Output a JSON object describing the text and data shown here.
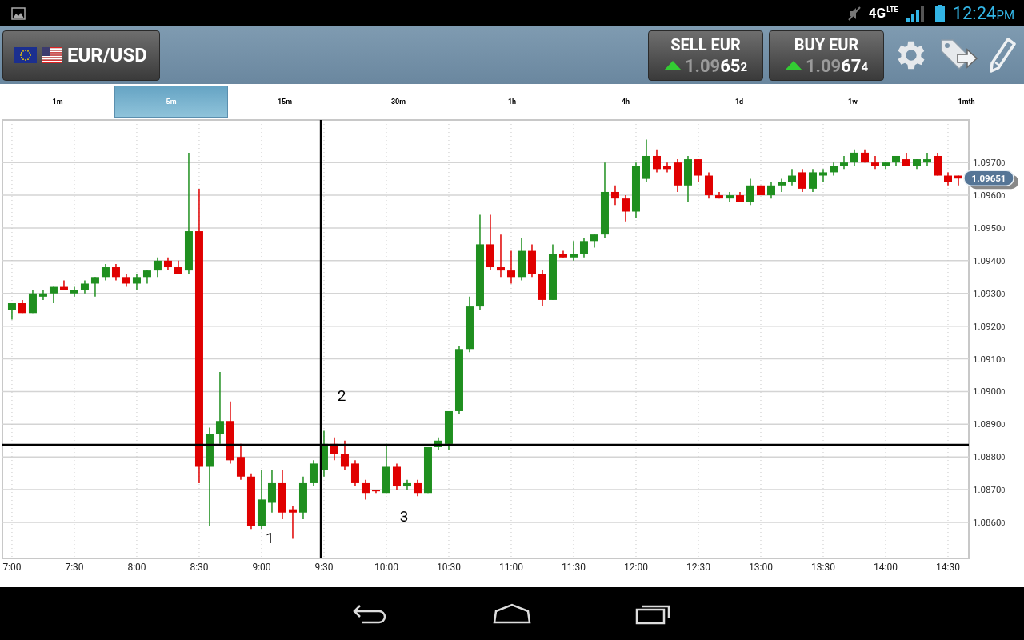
{
  "status_bar": {
    "network": "4G",
    "network_sub": "LTE",
    "time": "12:24",
    "meridiem": "PM"
  },
  "header": {
    "pair": "EUR/USD",
    "quotes": [
      {
        "label": "SELL EUR",
        "price_lead": "1.09",
        "price_pips": "65",
        "price_tail": "2"
      },
      {
        "label": "BUY EUR",
        "price_lead": "1.09",
        "price_pips": "67",
        "price_tail": "4"
      }
    ]
  },
  "tabs": [
    {
      "label": "1m",
      "selected": false
    },
    {
      "label": "5m",
      "selected": true
    },
    {
      "label": "15m",
      "selected": false
    },
    {
      "label": "30m",
      "selected": false
    },
    {
      "label": "1h",
      "selected": false
    },
    {
      "label": "4h",
      "selected": false
    },
    {
      "label": "1d",
      "selected": false
    },
    {
      "label": "1w",
      "selected": false
    },
    {
      "label": "1mth",
      "selected": false
    }
  ],
  "chart": {
    "price_tag": "1.09651",
    "chart_data": {
      "type": "candlestick",
      "grid": true,
      "ylim": [
        1.0849,
        1.0983
      ],
      "ref_lines": [
        {
          "axis": "y",
          "value": 1.08837
        }
      ],
      "categories": [
        "7:00",
        null,
        null,
        null,
        null,
        null,
        "7:30",
        null,
        null,
        null,
        null,
        null,
        "8:00",
        null,
        null,
        null,
        null,
        null,
        "8:30",
        null,
        null,
        null,
        null,
        null,
        "9:00",
        null,
        null,
        null,
        null,
        null,
        "9:30",
        null,
        null,
        null,
        null,
        null,
        "10:00",
        null,
        null,
        null,
        null,
        null,
        "10:30",
        null,
        null,
        null,
        null,
        null,
        "11:00",
        null,
        null,
        null,
        null,
        null,
        "11:30",
        null,
        null,
        null,
        null,
        null,
        "12:00",
        null,
        null,
        null,
        null,
        null,
        "12:30",
        null,
        null,
        null,
        null,
        null,
        "13:00",
        null,
        null,
        null,
        null,
        null,
        "13:30",
        null,
        null,
        null,
        null,
        null,
        "14:00",
        null,
        null,
        null,
        null,
        null,
        "14:30",
        null
      ],
      "yticks": [
        {
          "value": 1.097,
          "label": "1.09700"
        },
        {
          "value": 1.096,
          "label": "1.09600"
        },
        {
          "value": 1.095,
          "label": "1.09500"
        },
        {
          "value": 1.094,
          "label": "1.09400"
        },
        {
          "value": 1.093,
          "label": "1.09300"
        },
        {
          "value": 1.092,
          "label": "1.09200"
        },
        {
          "value": 1.091,
          "label": "1.09100"
        },
        {
          "value": 1.09,
          "label": "1.09000"
        },
        {
          "value": 1.089,
          "label": "1.08900"
        },
        {
          "value": 1.088,
          "label": "1.08800"
        },
        {
          "value": 1.087,
          "label": "1.08700"
        },
        {
          "value": 1.086,
          "label": "1.08600"
        }
      ],
      "annotations": [
        "1",
        "2",
        "3"
      ],
      "ohlc": [
        [
          1.0925,
          1.0927,
          1.0922,
          1.0927
        ],
        [
          1.0927,
          1.0928,
          1.0924,
          1.0924
        ],
        [
          1.0924,
          1.0931,
          1.0924,
          1.093
        ],
        [
          1.0929,
          1.0931,
          1.0928,
          1.093
        ],
        [
          1.093,
          1.0932,
          1.0927,
          1.0932
        ],
        [
          1.0932,
          1.0934,
          1.0931,
          1.0931
        ],
        [
          1.093,
          1.0932,
          1.0929,
          1.0931
        ],
        [
          1.0931,
          1.0934,
          1.093,
          1.0933
        ],
        [
          1.0933,
          1.0935,
          1.0929,
          1.0935
        ],
        [
          1.0935,
          1.0939,
          1.0934,
          1.0938
        ],
        [
          1.0938,
          1.0939,
          1.0934,
          1.0935
        ],
        [
          1.0935,
          1.0936,
          1.0932,
          1.0933
        ],
        [
          1.0933,
          1.0936,
          1.0931,
          1.0935
        ],
        [
          1.0935,
          1.0937,
          1.0933,
          1.0937
        ],
        [
          1.0937,
          1.0941,
          1.0935,
          1.094
        ],
        [
          1.094,
          1.0941,
          1.0937,
          1.0938
        ],
        [
          1.0938,
          1.094,
          1.0936,
          1.0936
        ],
        [
          1.0937,
          1.0973,
          1.0936,
          1.0949
        ],
        [
          1.0949,
          1.0962,
          1.0872,
          1.0877
        ],
        [
          1.0877,
          1.0889,
          1.0859,
          1.0887
        ],
        [
          1.0887,
          1.0906,
          1.0884,
          1.0891
        ],
        [
          1.0891,
          1.0897,
          1.0878,
          1.0879
        ],
        [
          1.088,
          1.0884,
          1.0873,
          1.0874
        ],
        [
          1.0874,
          1.0875,
          1.0858,
          1.0859
        ],
        [
          1.0859,
          1.0876,
          1.0858,
          1.0867
        ],
        [
          1.0866,
          1.0876,
          1.0863,
          1.0872
        ],
        [
          1.0872,
          1.0876,
          1.0861,
          1.0863
        ],
        [
          1.0864,
          1.0865,
          1.0855,
          1.0863
        ],
        [
          1.0863,
          1.0874,
          1.0861,
          1.0872
        ],
        [
          1.0872,
          1.0879,
          1.0871,
          1.0878
        ],
        [
          1.0876,
          1.0888,
          1.0874,
          1.0884
        ],
        [
          1.0884,
          1.0886,
          1.0879,
          1.0881
        ],
        [
          1.0881,
          1.0885,
          1.0876,
          1.0877
        ],
        [
          1.0878,
          1.0879,
          1.0871,
          1.0872
        ],
        [
          1.0872,
          1.0873,
          1.0867,
          1.0869
        ],
        [
          1.087,
          1.087,
          1.0869,
          1.08695
        ],
        [
          1.0869,
          1.0884,
          1.0869,
          1.0877
        ],
        [
          1.0877,
          1.0878,
          1.087,
          1.0871
        ],
        [
          1.0871,
          1.0873,
          1.087,
          1.0872
        ],
        [
          1.0872,
          1.0873,
          1.0868,
          1.0869
        ],
        [
          1.0869,
          1.0883,
          1.0869,
          1.0883
        ],
        [
          1.0883,
          1.0886,
          1.0882,
          1.0885
        ],
        [
          1.0884,
          1.0894,
          1.0882,
          1.0894
        ],
        [
          1.0894,
          1.0914,
          1.0893,
          1.0913
        ],
        [
          1.0913,
          1.0929,
          1.0912,
          1.0926
        ],
        [
          1.0926,
          1.0954,
          1.0925,
          1.0945
        ],
        [
          1.0945,
          1.0954,
          1.0937,
          1.0938
        ],
        [
          1.0938,
          1.0948,
          1.0935,
          1.0937
        ],
        [
          1.0937,
          1.0943,
          1.0933,
          1.0935
        ],
        [
          1.0935,
          1.0947,
          1.0934,
          1.0943
        ],
        [
          1.0943,
          1.0945,
          1.0935,
          1.0936
        ],
        [
          1.0936,
          1.0937,
          1.0926,
          1.0928
        ],
        [
          1.0928,
          1.0945,
          1.0928,
          1.0942
        ],
        [
          1.0942,
          1.0943,
          1.0941,
          1.0941
        ],
        [
          1.0941,
          1.0946,
          1.094,
          1.0942
        ],
        [
          1.0942,
          1.0947,
          1.0941,
          1.0946
        ],
        [
          1.0946,
          1.0948,
          1.0944,
          1.0948
        ],
        [
          1.0948,
          1.097,
          1.0947,
          1.0961
        ],
        [
          1.0961,
          1.0963,
          1.0957,
          1.0959
        ],
        [
          1.0959,
          1.096,
          1.0952,
          1.0955
        ],
        [
          1.0955,
          1.097,
          1.0953,
          1.0969
        ],
        [
          1.0965,
          1.0977,
          1.0964,
          1.0972
        ],
        [
          1.0972,
          1.0974,
          1.0967,
          1.0968
        ],
        [
          1.0969,
          1.097,
          1.0967,
          1.0968
        ],
        [
          1.097,
          1.0971,
          1.0961,
          1.0963
        ],
        [
          1.0963,
          1.0972,
          1.0958,
          1.0971
        ],
        [
          1.0971,
          1.0971,
          1.0964,
          1.0966
        ],
        [
          1.0966,
          1.0967,
          1.0959,
          1.096
        ],
        [
          1.096,
          1.0961,
          1.0959,
          1.0959
        ],
        [
          1.0959,
          1.0961,
          1.0958,
          1.096
        ],
        [
          1.096,
          1.0961,
          1.0958,
          1.0958
        ],
        [
          1.0958,
          1.0965,
          1.0957,
          1.0963
        ],
        [
          1.0963,
          1.0963,
          1.096,
          1.096
        ],
        [
          1.096,
          1.0964,
          1.0959,
          1.0963
        ],
        [
          1.0963,
          1.0965,
          1.0961,
          1.0964
        ],
        [
          1.0964,
          1.0968,
          1.0963,
          1.0966
        ],
        [
          1.0967,
          1.0968,
          1.0961,
          1.0962
        ],
        [
          1.0962,
          1.0968,
          1.0961,
          1.0967
        ],
        [
          1.0966,
          1.0968,
          1.0964,
          1.0967
        ],
        [
          1.0967,
          1.097,
          1.0966,
          1.0969
        ],
        [
          1.0969,
          1.0972,
          1.0968,
          1.097
        ],
        [
          1.097,
          1.0974,
          1.0969,
          1.0973
        ],
        [
          1.0973,
          1.0974,
          1.097,
          1.097
        ],
        [
          1.097,
          1.0972,
          1.0968,
          1.0969
        ],
        [
          1.0969,
          1.097,
          1.0968,
          1.097
        ],
        [
          1.097,
          1.0972,
          1.0969,
          1.0972
        ],
        [
          1.0971,
          1.0973,
          1.0969,
          1.0969
        ],
        [
          1.0969,
          1.0971,
          1.0968,
          1.0971
        ],
        [
          1.097,
          1.0973,
          1.0969,
          1.0971
        ],
        [
          1.0972,
          1.0973,
          1.0966,
          1.0966
        ],
        [
          1.0966,
          1.0967,
          1.0963,
          1.0964
        ],
        [
          1.0966,
          1.0966,
          1.0963,
          1.09651
        ]
      ]
    }
  }
}
